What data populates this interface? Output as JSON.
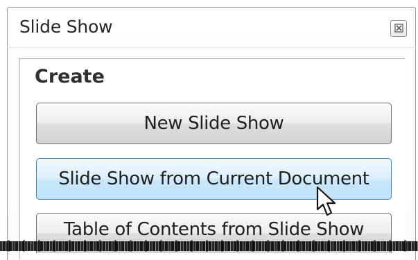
{
  "window": {
    "title": "Slide Show"
  },
  "section": {
    "title": "Create"
  },
  "buttons": {
    "new_slide_show": "New Slide Show",
    "slide_show_from_current_document": "Slide Show from Current Document",
    "table_of_contents_from_slide_show": "Table of Contents from Slide Show"
  },
  "icons": {
    "close": "close-icon",
    "cursor": "mouse-cursor-icon"
  },
  "colors": {
    "hover_button": "#cbe8fb",
    "hover_border": "#3c7fb1"
  }
}
